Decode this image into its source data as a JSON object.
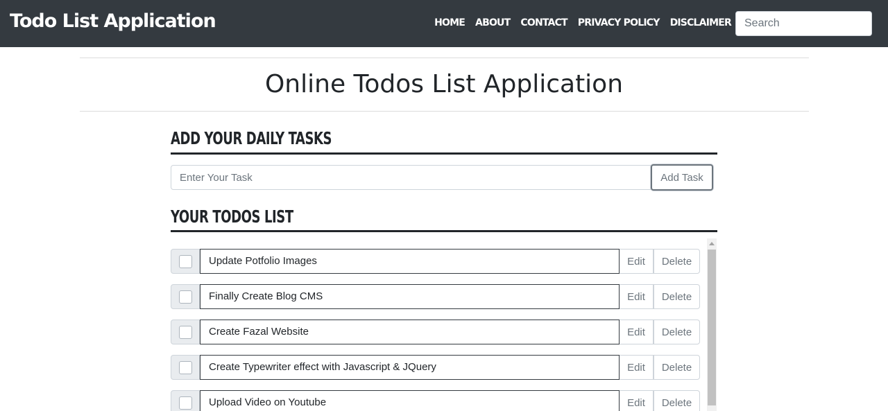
{
  "navbar": {
    "brand": "Todo List Application",
    "links": [
      "HOME",
      "ABOUT",
      "CONTACT",
      "PRIVACY POLICY",
      "DISCLAIMER"
    ],
    "search_placeholder": "Search"
  },
  "page": {
    "title": "Online Todos List Application"
  },
  "add_section": {
    "heading": "ADD YOUR DAILY TASKS",
    "input_placeholder": "Enter Your Task",
    "button_label": "Add Task"
  },
  "list_section": {
    "heading": "YOUR TODOS LIST",
    "edit_label": "Edit",
    "delete_label": "Delete",
    "items": [
      {
        "text": "Update Potfolio Images"
      },
      {
        "text": "Finally Create Blog CMS"
      },
      {
        "text": "Create Fazal Website"
      },
      {
        "text": "Create Typewriter effect with Javascript & JQuery"
      },
      {
        "text": "Upload Video on Youtube"
      }
    ]
  }
}
